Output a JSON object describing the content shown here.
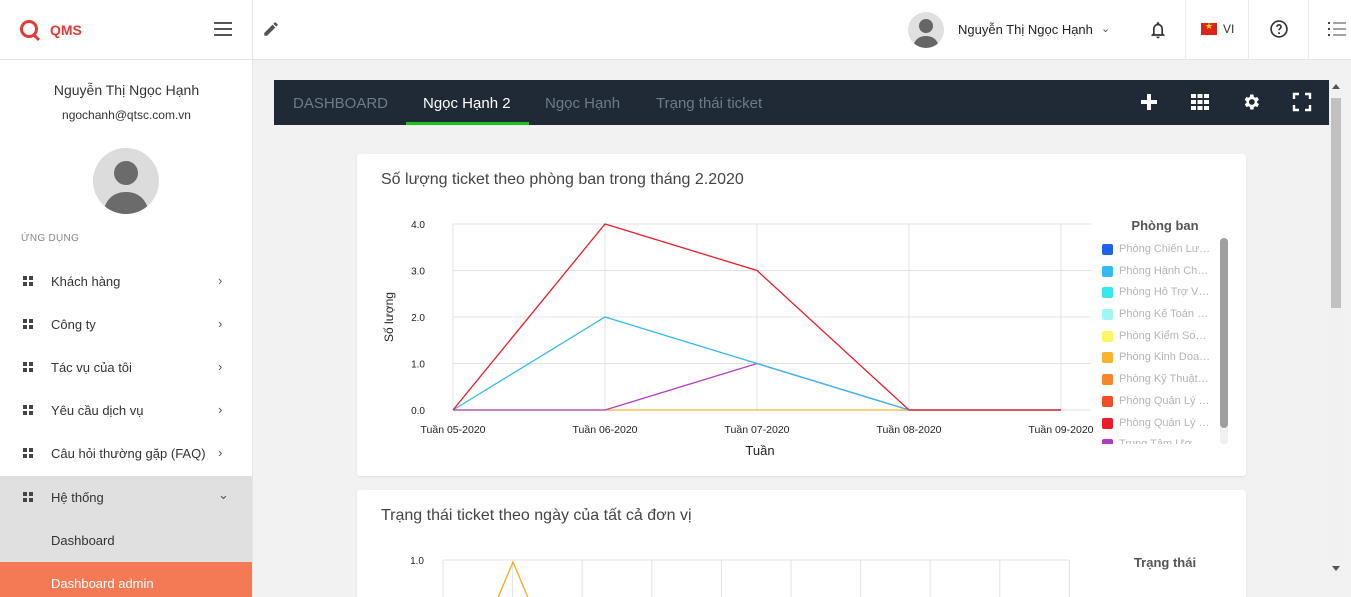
{
  "app": {
    "brand": "QMS"
  },
  "topbar": {
    "username": "Nguyễn Thị Ngọc Hạnh",
    "language": "VI"
  },
  "sidebar": {
    "name": "Nguyễn Thị Ngọc Hạnh",
    "email": "ngochanh@qtsc.com.vn",
    "section": "ỨNG DỤNG",
    "items": [
      {
        "label": "Khách hàng"
      },
      {
        "label": "Công ty"
      },
      {
        "label": "Tác vụ của tôi"
      },
      {
        "label": "Yêu cầu dịch vụ"
      },
      {
        "label": "Câu hỏi thường gặp (FAQ)"
      },
      {
        "label": "Hệ thống"
      }
    ],
    "subitems": [
      {
        "label": "Dashboard"
      },
      {
        "label": "Dashboard admin"
      }
    ]
  },
  "tabs": [
    {
      "label": "DASHBOARD"
    },
    {
      "label": "Ngọc Hạnh 2"
    },
    {
      "label": "Ngọc Hạnh"
    },
    {
      "label": "Trạng thái ticket"
    }
  ],
  "card1": {
    "title": "Số lượng ticket theo phòng ban trong tháng 2.2020"
  },
  "card2": {
    "title": "Trạng thái ticket theo ngày của tất cả đơn vị"
  },
  "chart_data": [
    {
      "type": "line",
      "title": "Số lượng ticket theo phòng ban trong tháng 2.2020",
      "xlabel": "Tuần",
      "ylabel": "Số lượng",
      "categories": [
        "Tuần 05-2020",
        "Tuần 06-2020",
        "Tuần 07-2020",
        "Tuần 08-2020",
        "Tuần 09-2020"
      ],
      "yticks": [
        "0.0",
        "1.0",
        "2.0",
        "3.0",
        "4.0"
      ],
      "ylim": [
        0,
        4
      ],
      "grid": true,
      "legend_title": "Phòng ban",
      "legend_position": "right",
      "legend": [
        {
          "name": "Phòng Chiến Lư…",
          "color": "#1e62e6"
        },
        {
          "name": "Phòng Hành Chí…",
          "color": "#36b9ef"
        },
        {
          "name": "Phòng Hỗ Trợ V…",
          "color": "#39e8ec"
        },
        {
          "name": "Phòng Kế Toán …",
          "color": "#9ff6f3"
        },
        {
          "name": "Phòng Kiểm Soá…",
          "color": "#fbf665"
        },
        {
          "name": "Phòng Kinh Doanh",
          "color": "#f8b42c"
        },
        {
          "name": "Phòng Kỹ Thuật …",
          "color": "#f5862a"
        },
        {
          "name": "Phòng Quản Lý …",
          "color": "#ef4e23"
        },
        {
          "name": "Phòng Quản Lý …",
          "color": "#ea1c2a"
        },
        {
          "name": "Trung Tâm Ươm…",
          "color": "#b23cc1"
        }
      ],
      "series": [
        {
          "name": "Phòng Quản Lý …",
          "color": "#ea1c2a",
          "values": [
            0,
            4,
            3,
            0,
            0
          ]
        },
        {
          "name": "Phòng Hành Chí…",
          "color": "#36b9ef",
          "values": [
            0,
            2,
            1,
            0,
            0
          ]
        },
        {
          "name": "Trung Tâm Ươm…",
          "color": "#b23cc1",
          "values": [
            0,
            0,
            1,
            0,
            0
          ]
        },
        {
          "name": "Phòng Kinh Doanh",
          "color": "#f8b42c",
          "values": [
            0,
            0,
            0,
            0,
            0
          ]
        }
      ]
    },
    {
      "type": "line",
      "title": "Trạng thái ticket theo ngày của tất cả đơn vị",
      "yticks": [
        "1.0"
      ],
      "legend_title": "Trạng thái",
      "legend_position": "right"
    }
  ]
}
